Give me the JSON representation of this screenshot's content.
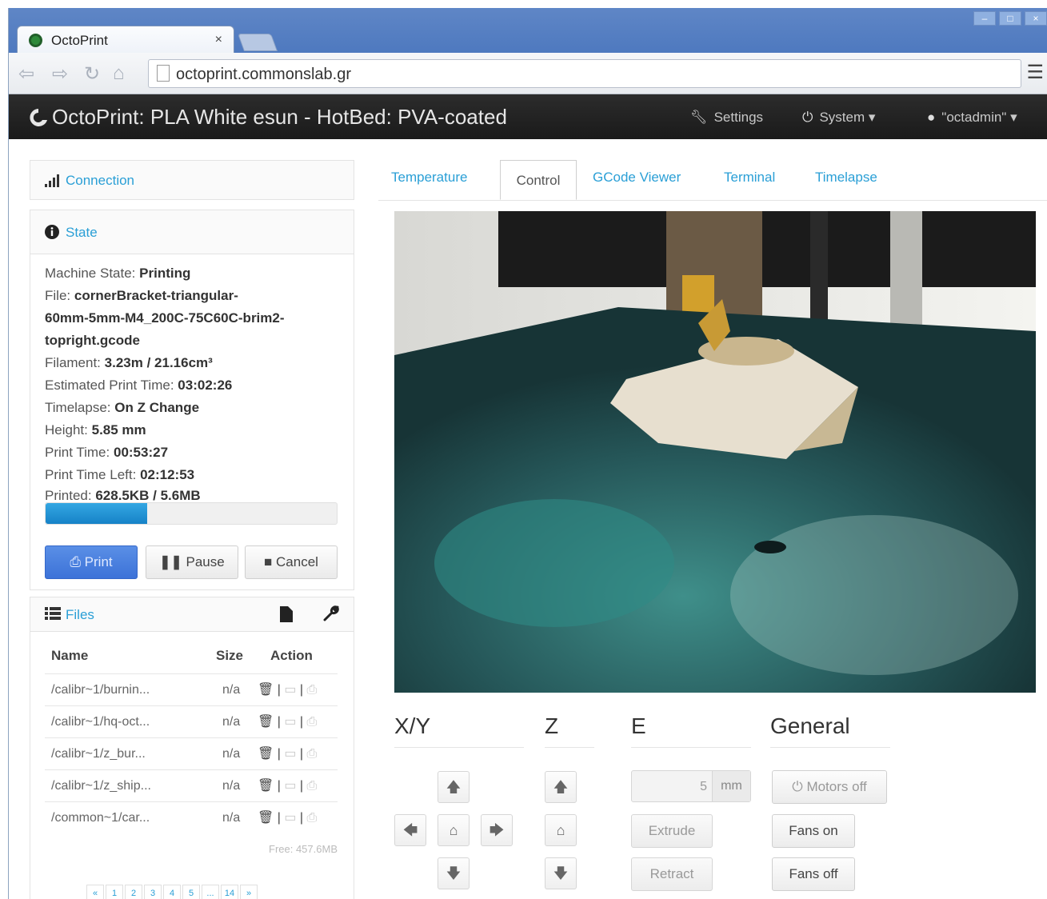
{
  "browser": {
    "tab_title": "OctoPrint",
    "tab_close": "×",
    "url": "octoprint.commonslab.gr",
    "menu_glyph": "☰"
  },
  "navbar": {
    "brand": "OctoPrint: PLA White esun - HotBed: PVA-coated",
    "settings": "Settings",
    "system": "System",
    "user": "\"octadmin\""
  },
  "connection": {
    "title": "Connection"
  },
  "state": {
    "title": "State",
    "machine_state_label": "Machine State:",
    "machine_state": "Printing",
    "file_label": "File:",
    "file_line1": "cornerBracket-triangular-",
    "file_line2": "60mm-5mm-M4_200C-75C60C-brim2-",
    "file_line3": "topright.gcode",
    "filament_label": "Filament:",
    "filament": "3.23m / 21.16cm³",
    "est_label": "Estimated Print Time:",
    "est": "03:02:26",
    "timelapse_label": "Timelapse:",
    "timelapse": "On Z Change",
    "height_label": "Height:",
    "height": "5.85 mm",
    "print_time_label": "Print Time:",
    "print_time": "00:53:27",
    "time_left_label": "Print Time Left:",
    "time_left": "02:12:53",
    "printed_label": "Printed:",
    "printed": "628.5KB / 5.6MB",
    "progress": 0.35
  },
  "buttons": {
    "print": "Print",
    "pause": "Pause",
    "cancel": "Cancel"
  },
  "files": {
    "title": "Files",
    "columns": {
      "name": "Name",
      "size": "Size",
      "action": "Action"
    },
    "rows": [
      {
        "name": "/calibr~1/burnin...",
        "size": "n/a"
      },
      {
        "name": "/calibr~1/hq-oct...",
        "size": "n/a"
      },
      {
        "name": "/calibr~1/z_bur...",
        "size": "n/a"
      },
      {
        "name": "/calibr~1/z_ship...",
        "size": "n/a"
      },
      {
        "name": "/common~1/car...",
        "size": "n/a"
      }
    ],
    "free": "Free: 457.6MB",
    "pagination": [
      "«",
      "1",
      "2",
      "3",
      "4",
      "5",
      "...",
      "14",
      "»"
    ]
  },
  "tabs": {
    "temperature": "Temperature",
    "control": "Control",
    "gcode_viewer": "GCode Viewer",
    "terminal": "Terminal",
    "timelapse": "Timelapse"
  },
  "control": {
    "xy": "X/Y",
    "z": "Z",
    "e": "E",
    "general": "General",
    "extrude_amount": "5",
    "extrude_unit": "mm",
    "extrude": "Extrude",
    "retract": "Retract",
    "motors_off": "Motors off",
    "fans_on": "Fans on",
    "fans_off": "Fans off"
  },
  "colors": {
    "accent": "#2a9fd6",
    "primary_button": "#3c72d8",
    "navbar": "#1f1f1f"
  }
}
